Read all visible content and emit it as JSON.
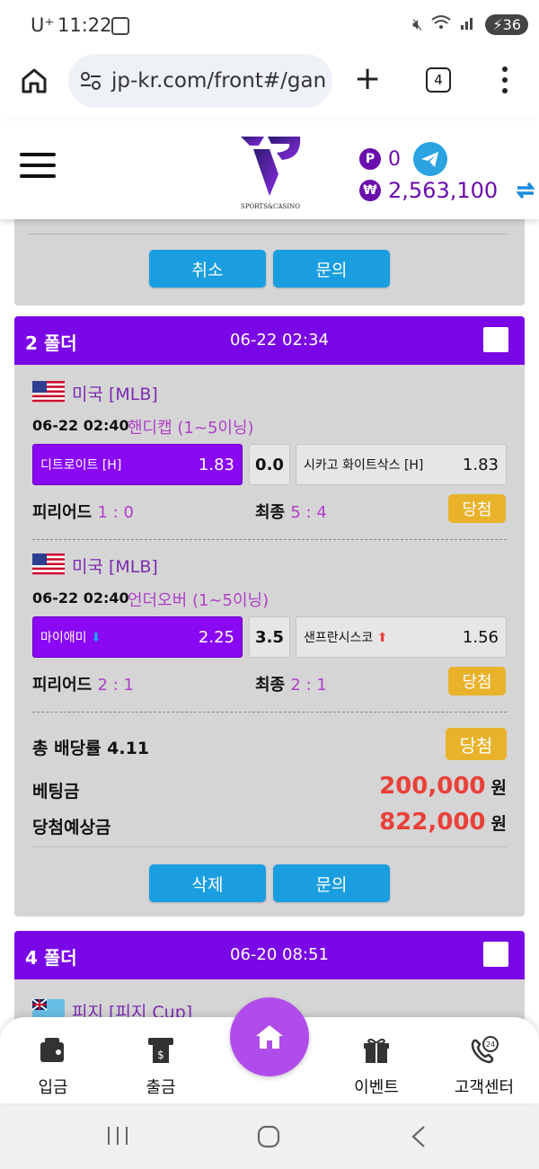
{
  "status_bar": {
    "carrier": "U⁺",
    "time": "11:22",
    "battery": "36"
  },
  "browser": {
    "url": "jp-kr.com/front#/gan",
    "tab_count": "4"
  },
  "header": {
    "logo_tagline": "SPORTS&CASINO",
    "points_badge": "P",
    "points_value": "0",
    "balance_badge": "₩",
    "balance_value": "2,563,100"
  },
  "top_card": {
    "cancel_label": "취소",
    "inquiry_label": "문의"
  },
  "main_card": {
    "folder": "2 폴더",
    "datetime": "06-22 02:34",
    "games": [
      {
        "country": "미국 [MLB]",
        "time": "06-22 02:40",
        "market": "핸디캡 (1~5이닝)",
        "home": "디트로이트 [H]",
        "home_odd": "1.83",
        "line": "0.0",
        "away": "시카고 화이트삭스 [H]",
        "away_odd": "1.83",
        "period_label": "피리어드",
        "period_score": "1 : 0",
        "final_label": "최종",
        "final_score": "5 : 4",
        "result": "당첨"
      },
      {
        "country": "미국 [MLB]",
        "time": "06-22 02:40",
        "market": "언더오버 (1~5이닝)",
        "home": "마이애미",
        "home_odd": "2.25",
        "line": "3.5",
        "away": "샌프란시스코",
        "away_odd": "1.56",
        "period_label": "피리어드",
        "period_score": "2 : 1",
        "final_label": "최종",
        "final_score": "2 : 1",
        "result": "당첨"
      }
    ],
    "total_odds_label": "총 배당률 4.11",
    "total_result": "당첨",
    "bet_label": "베팅금",
    "bet_amount": "200,000",
    "expected_label": "당첨예상금",
    "expected_amount": "822,000",
    "currency": "원",
    "delete_label": "삭제",
    "inquiry_label": "문의"
  },
  "bottom_card": {
    "folder": "4 폴더",
    "datetime": "06-20 08:51",
    "country": "피지 [피지 Cup]"
  },
  "bottom_nav": {
    "deposit": "입금",
    "withdraw": "출금",
    "event": "이벤트",
    "support": "고객센터"
  },
  "colors": {
    "purple": "#7a08e6",
    "blue_button": "#1a9ee0",
    "gold": "#e8b22a",
    "red_amount": "#e8413a"
  }
}
